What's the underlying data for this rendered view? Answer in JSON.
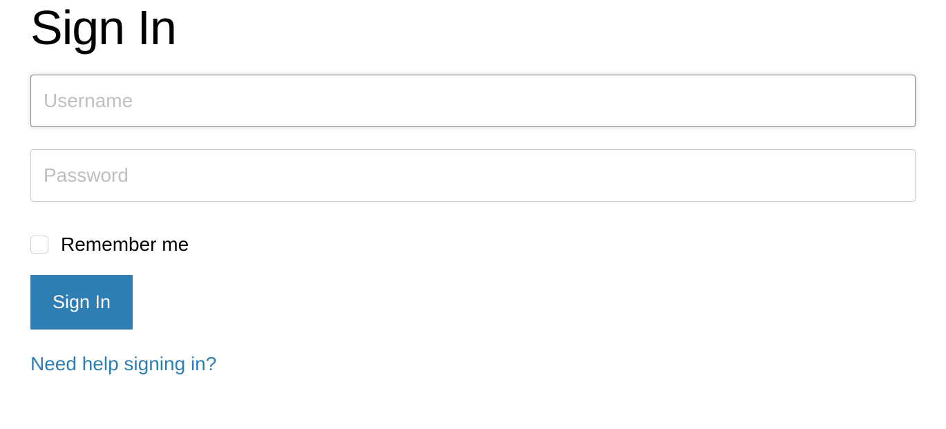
{
  "page": {
    "title": "Sign In"
  },
  "form": {
    "username": {
      "placeholder": "Username",
      "value": ""
    },
    "password": {
      "placeholder": "Password",
      "value": ""
    },
    "remember": {
      "label": "Remember me",
      "checked": false
    },
    "submit": {
      "label": "Sign In"
    },
    "help": {
      "label": "Need help signing in?"
    }
  }
}
